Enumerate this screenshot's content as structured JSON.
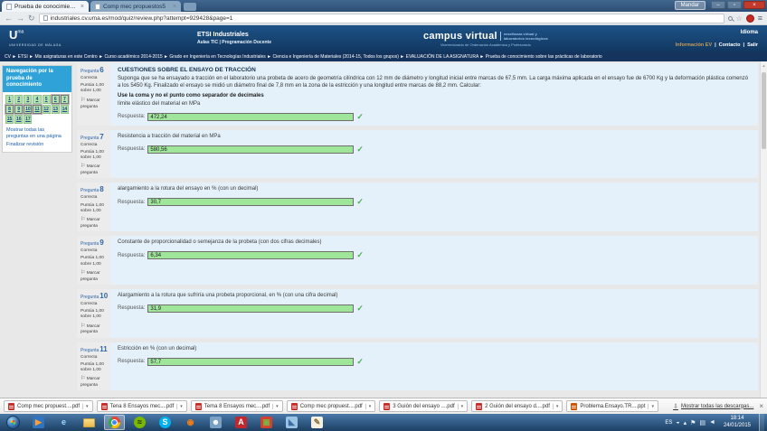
{
  "browser": {
    "tabs": [
      {
        "title": "Prueba de conocimiento:"
      },
      {
        "title": "Comp mec propuestos5"
      }
    ],
    "tab_close_glyph": "×",
    "profile_button": "Mandar",
    "window_controls": [
      {
        "name": "minimize",
        "glyph": "–"
      },
      {
        "name": "maximize",
        "glyph": "▫"
      },
      {
        "name": "close",
        "glyph": "×"
      }
    ],
    "toolbar": {
      "back": "←",
      "forward": "→",
      "reload": "↻",
      "bookmark_star": "☆",
      "menu": "≡"
    },
    "url": "industriales.cv.uma.es/mod/quiz/review.php?attempt=929428&page=1"
  },
  "header": {
    "uma": {
      "mark": "U",
      "sup": "ma",
      "caption": "UNIVERSIDAD DE MÁLAGA"
    },
    "center_title": "ETSI Industriales",
    "center_subtitle": "Aulas TIC  |  Programación Docente",
    "brand": "campus virtual",
    "brand_tag1": "enseñanza virtual y",
    "brand_tag2": "laboratorios tecnológicos",
    "brand_sub": "Vicerrectorado de Ordenación Académica y Profesorado",
    "lang_label": "Idioma",
    "links": [
      {
        "label": "Información EV",
        "color": "#c89b5a"
      },
      {
        "label": "Contacto",
        "color": "#ffffff"
      },
      {
        "label": "Salir",
        "color": "#ffffff"
      }
    ]
  },
  "breadcrumb": "CV ► ETSI ► Mis asignaturas en este Centro ► Curso académico 2014-2015 ► Grado en Ingeniería en Tecnologías Industriales ► Ciencia e Ingeniería de Materiales (2014-15, Todos los grupos) ► EVALUACIÓN DE LA ASIGNATURA ► Prueba de conocimiento sobre las prácticas de laboratorio",
  "sidebar": {
    "title": "Navegación por la prueba de conocimiento",
    "questions": [
      {
        "label": "1",
        "current": false
      },
      {
        "label": "2",
        "current": false
      },
      {
        "label": "3",
        "current": false
      },
      {
        "label": "4",
        "current": false
      },
      {
        "label": "5",
        "current": false
      },
      {
        "label": "6",
        "current": true
      },
      {
        "label": "7",
        "current": true
      },
      {
        "label": "8",
        "current": true
      },
      {
        "label": "9",
        "current": true
      },
      {
        "label": "10",
        "current": true
      },
      {
        "label": "11",
        "current": true
      },
      {
        "label": "12",
        "current": false
      },
      {
        "label": "13",
        "current": false
      },
      {
        "label": "14",
        "current": false
      },
      {
        "label": "15",
        "current": false
      },
      {
        "label": "16",
        "current": false
      },
      {
        "label": "17",
        "current": false
      }
    ],
    "link_show_all": "Mostrar todas las preguntas en una página",
    "link_finish": "Finalizar revisión"
  },
  "quiz": {
    "flag_glyph": "⚐",
    "questions": [
      {
        "label": "Pregunta",
        "number": "6",
        "state": "Correcta",
        "grade": "Puntúa 1,00 sobre 1,00",
        "flag": "Marcar pregunta",
        "title": "CUESTIONES SOBRE EL ENSAYO DE TRACCIÓN",
        "body": "Suponga que se ha ensayado a tracción en el laboratorio una probeta de acero de geometría cilíndrica con 12 mm de diámetro y longitud inicial entre marcas de 67,5 mm. La carga máxima aplicada en el ensayo fue de 6700 Kg y la deformación plástica comenzó a los 5450 Kg. Finalizado el ensayo se midió un diámetro final de 7,8 mm en la zona de la estricción y una longitud entre marcas de 88,2 mm. Calcular:",
        "note": "Use la coma y no el punto como separador de decimales",
        "prompt": "límite elástico del material en MPa",
        "answer_label": "Respuesta:",
        "answer": "472,24",
        "check": "✓"
      },
      {
        "label": "Pregunta",
        "number": "7",
        "state": "Correcta",
        "grade": "Puntúa 1,00 sobre 1,00",
        "flag": "Marcar pregunta",
        "prompt": "Resistencia a tracción del material en MPa",
        "answer_label": "Respuesta:",
        "answer": "580,56",
        "check": "✓"
      },
      {
        "label": "Pregunta",
        "number": "8",
        "state": "Correcta",
        "grade": "Puntúa 1,00 sobre 1,00",
        "flag": "Marcar pregunta",
        "prompt": "alargamiento a la rotura del ensayo en % (con un decimal)",
        "answer_label": "Respuesta:",
        "answer": "30,7",
        "check": "✓"
      },
      {
        "label": "Pregunta",
        "number": "9",
        "state": "Correcta",
        "grade": "Puntúa 1,00 sobre 1,00",
        "flag": "Marcar pregunta",
        "prompt": "Constante de proporcionalidad o semejanza de la probeta (con dos cifras decimales)",
        "answer_label": "Respuesta:",
        "answer": "6,34",
        "check": "✓"
      },
      {
        "label": "Pregunta",
        "number": "10",
        "state": "Correcta",
        "grade": "Puntúa 1,00 sobre 1,00",
        "flag": "Marcar pregunta",
        "prompt": "Alargamiento a la rotura que sufriría una probeta proporcional, en % (con una cifra decimal)",
        "answer_label": "Respuesta:",
        "answer": "31,9",
        "check": "✓"
      },
      {
        "label": "Pregunta",
        "number": "11",
        "state": "Correcta",
        "grade": "Puntúa 1,00 sobre 1,00",
        "flag": "Marcar pregunta",
        "prompt": "Estricción en % (con un decimal)",
        "answer_label": "Respuesta:",
        "answer": "57,7",
        "check": "✓"
      }
    ]
  },
  "downloads": {
    "items": [
      {
        "label": "Comp mec propuest....pdf",
        "type": "pdf"
      },
      {
        "label": "Tena 8 Ensayos mec....pdf",
        "type": "pdf"
      },
      {
        "label": "Tema 8 Ensayos mec....pdf",
        "type": "pdf"
      },
      {
        "label": "Comp mec propuest....pdf",
        "type": "pdf"
      },
      {
        "label": "3 Guión del ensayo ....pdf",
        "type": "pdf"
      },
      {
        "label": "2 Guión del ensayo d....pdf",
        "type": "pdf"
      },
      {
        "label": "Problema.Ensayo.TR....ppt",
        "type": "ppt"
      }
    ],
    "caret_glyph": "▾",
    "show_all": "Mostrar todas las descargas...",
    "arrow_glyph": "⇩",
    "close_glyph": "×"
  },
  "taskbar": {
    "icons": [
      {
        "name": "start-button",
        "shape": "orb"
      },
      {
        "name": "media-player-icon",
        "shape": "square",
        "glyph": "▶",
        "bg": "#2f74c0",
        "fg": "#ff9d2e"
      },
      {
        "name": "internet-explorer-icon",
        "shape": "square",
        "glyph": "e",
        "bg": "transparent",
        "fg": "#9fd8fa"
      },
      {
        "name": "file-explorer-icon",
        "shape": "folder"
      },
      {
        "name": "chrome-icon",
        "shape": "chrome",
        "active": true
      },
      {
        "name": "spotify-icon",
        "shape": "circle",
        "glyph": "≈",
        "bg": "#7ab800",
        "fg": "#1a1a1a"
      },
      {
        "name": "skype-icon",
        "shape": "circle",
        "glyph": "S",
        "bg": "#00b0f0",
        "fg": "#ffffff"
      },
      {
        "name": "orange-app-icon",
        "shape": "circle",
        "glyph": "◉",
        "bg": "transparent",
        "fg": "#f07d1a"
      },
      {
        "name": "contacts-icon",
        "shape": "square",
        "glyph": "☻",
        "bg": "#7aa0c4",
        "fg": "#ffffff"
      },
      {
        "name": "adobe-reader-icon",
        "shape": "square",
        "glyph": "A",
        "bg": "#c1272d",
        "fg": "#ffffff"
      },
      {
        "name": "office-app-icon",
        "shape": "square",
        "glyph": "▣",
        "bg": "#d43f2f",
        "fg": "#7cb342"
      },
      {
        "name": "photo-viewer-icon",
        "shape": "square",
        "glyph": "◣",
        "bg": "#9cc4e4",
        "fg": "#3a6ea5"
      },
      {
        "name": "paint-icon",
        "shape": "square",
        "glyph": "✎",
        "bg": "#f5f0e1",
        "fg": "#8a6d3b"
      }
    ],
    "tray": [
      {
        "name": "language-indicator",
        "text": "ES"
      },
      {
        "name": "action-center-icon",
        "glyph": "◒"
      },
      {
        "name": "hidden-icons-arrow",
        "glyph": "▴"
      },
      {
        "name": "flag-icon",
        "glyph": "⚑"
      },
      {
        "name": "network-icon",
        "glyph": "▤"
      },
      {
        "name": "volume-icon",
        "glyph": "◄"
      }
    ],
    "time": "18:14",
    "date": "24/01/2015"
  }
}
